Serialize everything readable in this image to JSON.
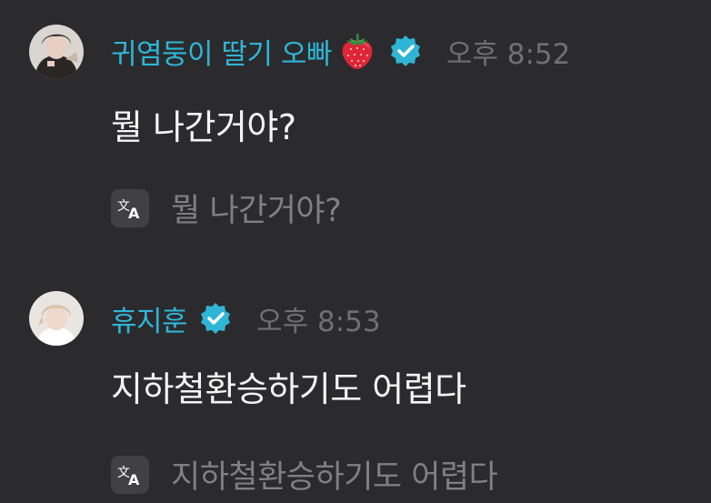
{
  "messages": [
    {
      "username": "귀염둥이 딸기 오빠",
      "username_emoji": "strawberry",
      "verified": true,
      "timestamp": "오후 8:52",
      "text": "뭘 나간거야?",
      "translation": "뭘 나간거야?"
    },
    {
      "username": "휴지훈",
      "verified": true,
      "timestamp": "오후 8:53",
      "text": "지하철환승하기도 어렵다",
      "translation": "지하철환승하기도 어렵다"
    }
  ],
  "colors": {
    "background": "#2b2b2d",
    "username": "#2fb5d6",
    "verified_badge": "#2fb5d6",
    "timestamp": "#6f6f74",
    "message_text": "#f4f4f4",
    "translation_text": "#7f7f84",
    "translate_button": "#414145"
  },
  "icons": {
    "verified": "verified-badge-icon",
    "translate": "translate-icon",
    "emoji": "strawberry-icon"
  }
}
